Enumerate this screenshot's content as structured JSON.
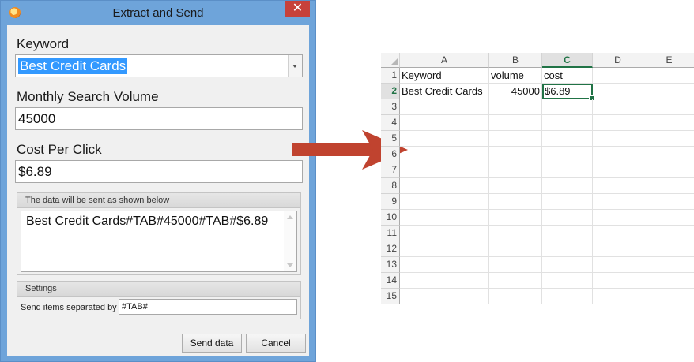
{
  "window": {
    "title": "Extract and Send",
    "close_glyph": "✕"
  },
  "form": {
    "keyword_label": "Keyword",
    "keyword_value": "Best Credit Cards",
    "volume_label": "Monthly Search Volume",
    "volume_value": "45000",
    "cpc_label": "Cost Per Click",
    "cpc_value": "$6.89"
  },
  "preview": {
    "title": "The data will be sent as shown below",
    "text": "Best Credit Cards#TAB#45000#TAB#$6.89"
  },
  "settings": {
    "title": "Settings",
    "separator_label": "Send items separated by",
    "separator_value": "#TAB#"
  },
  "buttons": {
    "send": "Send data",
    "cancel": "Cancel"
  },
  "spreadsheet": {
    "columns": [
      "A",
      "B",
      "C",
      "D",
      "E"
    ],
    "selected_column": "C",
    "rows": [
      "1",
      "2",
      "3",
      "4",
      "5",
      "6",
      "7",
      "8",
      "9",
      "10",
      "11",
      "12",
      "13",
      "14",
      "15"
    ],
    "selected_row": "2",
    "active_cell": "C2",
    "cells": {
      "A1": "Keyword",
      "B1": "volume",
      "C1": "cost",
      "A2": "Best Credit Cards",
      "B2": "45000",
      "C2": "$6.89"
    }
  },
  "colors": {
    "arrow": "#c0432f",
    "excel_green": "#217346",
    "window_frame": "#6ea4da",
    "selection": "#3399ff"
  },
  "icons": {
    "app": "app-icon",
    "close": "close-icon",
    "dropdown": "chevron-down-icon",
    "arrow": "right-arrow-icon"
  }
}
